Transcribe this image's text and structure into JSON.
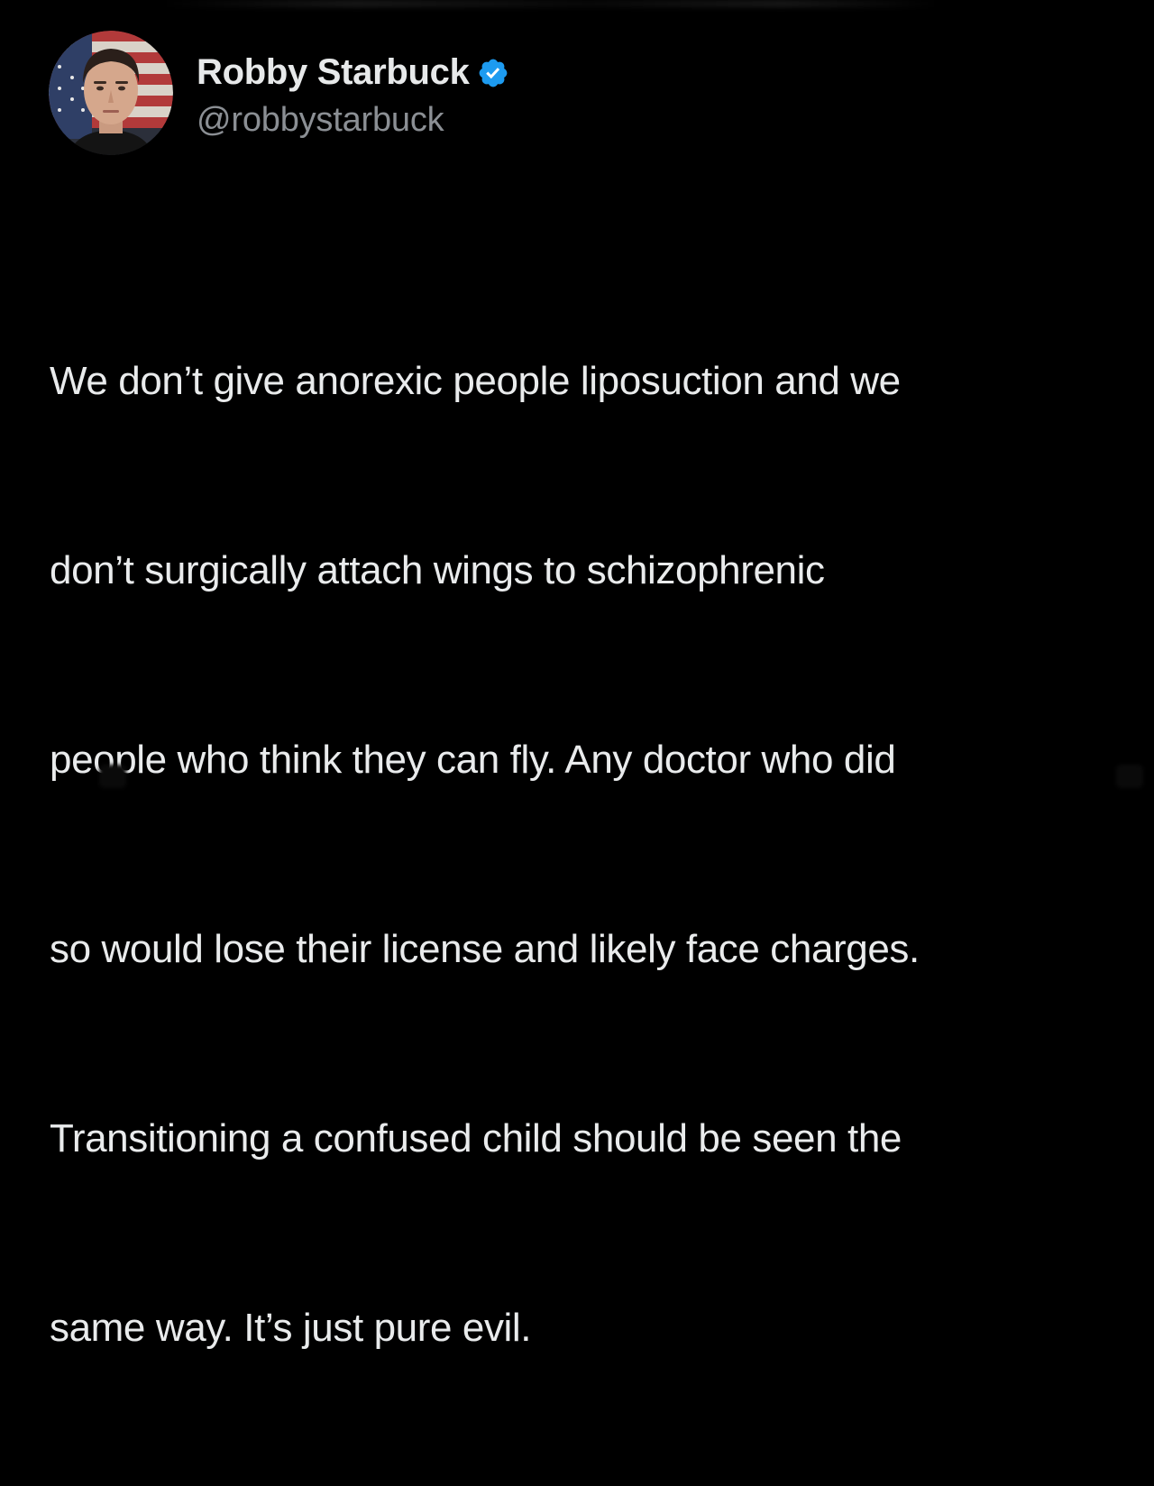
{
  "author": {
    "display_name": "Robby Starbuck",
    "handle": "@robbystarbuck",
    "verified": true,
    "avatar_icon": "profile-photo-with-us-flag-icon",
    "verified_icon": "verified-check-badge-icon"
  },
  "tweet": {
    "lines": [
      "We don’t give anorexic people liposuction and we",
      "don’t surgically attach wings to schizophrenic",
      "people who think they can fly. Any doctor who did",
      "so would lose their license and likely face charges.",
      "Transitioning a confused child should be seen the",
      "same way. It’s just pure evil."
    ]
  },
  "colors": {
    "background": "#000000",
    "text": "#e7e9ea",
    "handle": "#8b8f94",
    "verified_blue": "#1d9bf0"
  }
}
